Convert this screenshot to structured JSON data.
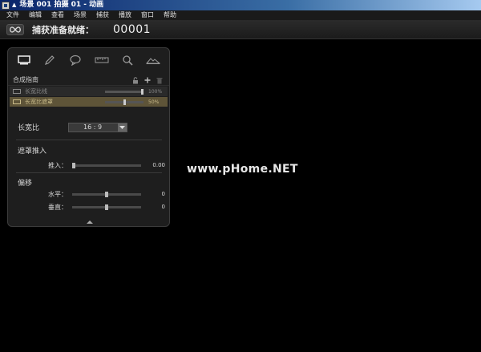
{
  "window": {
    "title": "场景 001   拍摄 01 - 动画",
    "title_dot": "▲"
  },
  "menu": {
    "items": [
      "文件",
      "编辑",
      "查看",
      "场景",
      "捕获",
      "播放",
      "窗口",
      "帮助"
    ]
  },
  "capture": {
    "loop_icon": "infinity-icon",
    "status": "捕获准备就绪：",
    "frame_number": "00001"
  },
  "panel": {
    "toolbar_icons": [
      "monitor-icon",
      "pencil-icon",
      "speech-bubble-icon",
      "ruler-icon",
      "magnifier-icon",
      "mountain-icon"
    ],
    "guides_section": {
      "title": "合成指南",
      "icons": [
        "lock-icon",
        "add-icon",
        "trash-icon"
      ],
      "rows": [
        {
          "name": "长宽比线",
          "value": "100%",
          "level": 1.0
        },
        {
          "name": "长宽比遮罩",
          "value": "50%",
          "level": 0.5
        }
      ]
    },
    "aspect": {
      "label": "长宽比",
      "selected": "16 : 9"
    },
    "mask_push": {
      "title": "遮罩推入",
      "param_label": "推入：",
      "value": "0.00",
      "level": 0.0
    },
    "offset": {
      "title": "偏移",
      "horizontal_label": "水平：",
      "horizontal_value": "0",
      "horizontal_level": 0.5,
      "vertical_label": "垂直：",
      "vertical_value": "0",
      "vertical_level": 0.5
    }
  },
  "watermark": {
    "text": "www.pHome.NET"
  },
  "colors": {
    "title_gradient_start": "#0a246a",
    "title_gradient_end": "#a6caf0",
    "highlight_row": "#5e5438",
    "background": "#000000"
  }
}
